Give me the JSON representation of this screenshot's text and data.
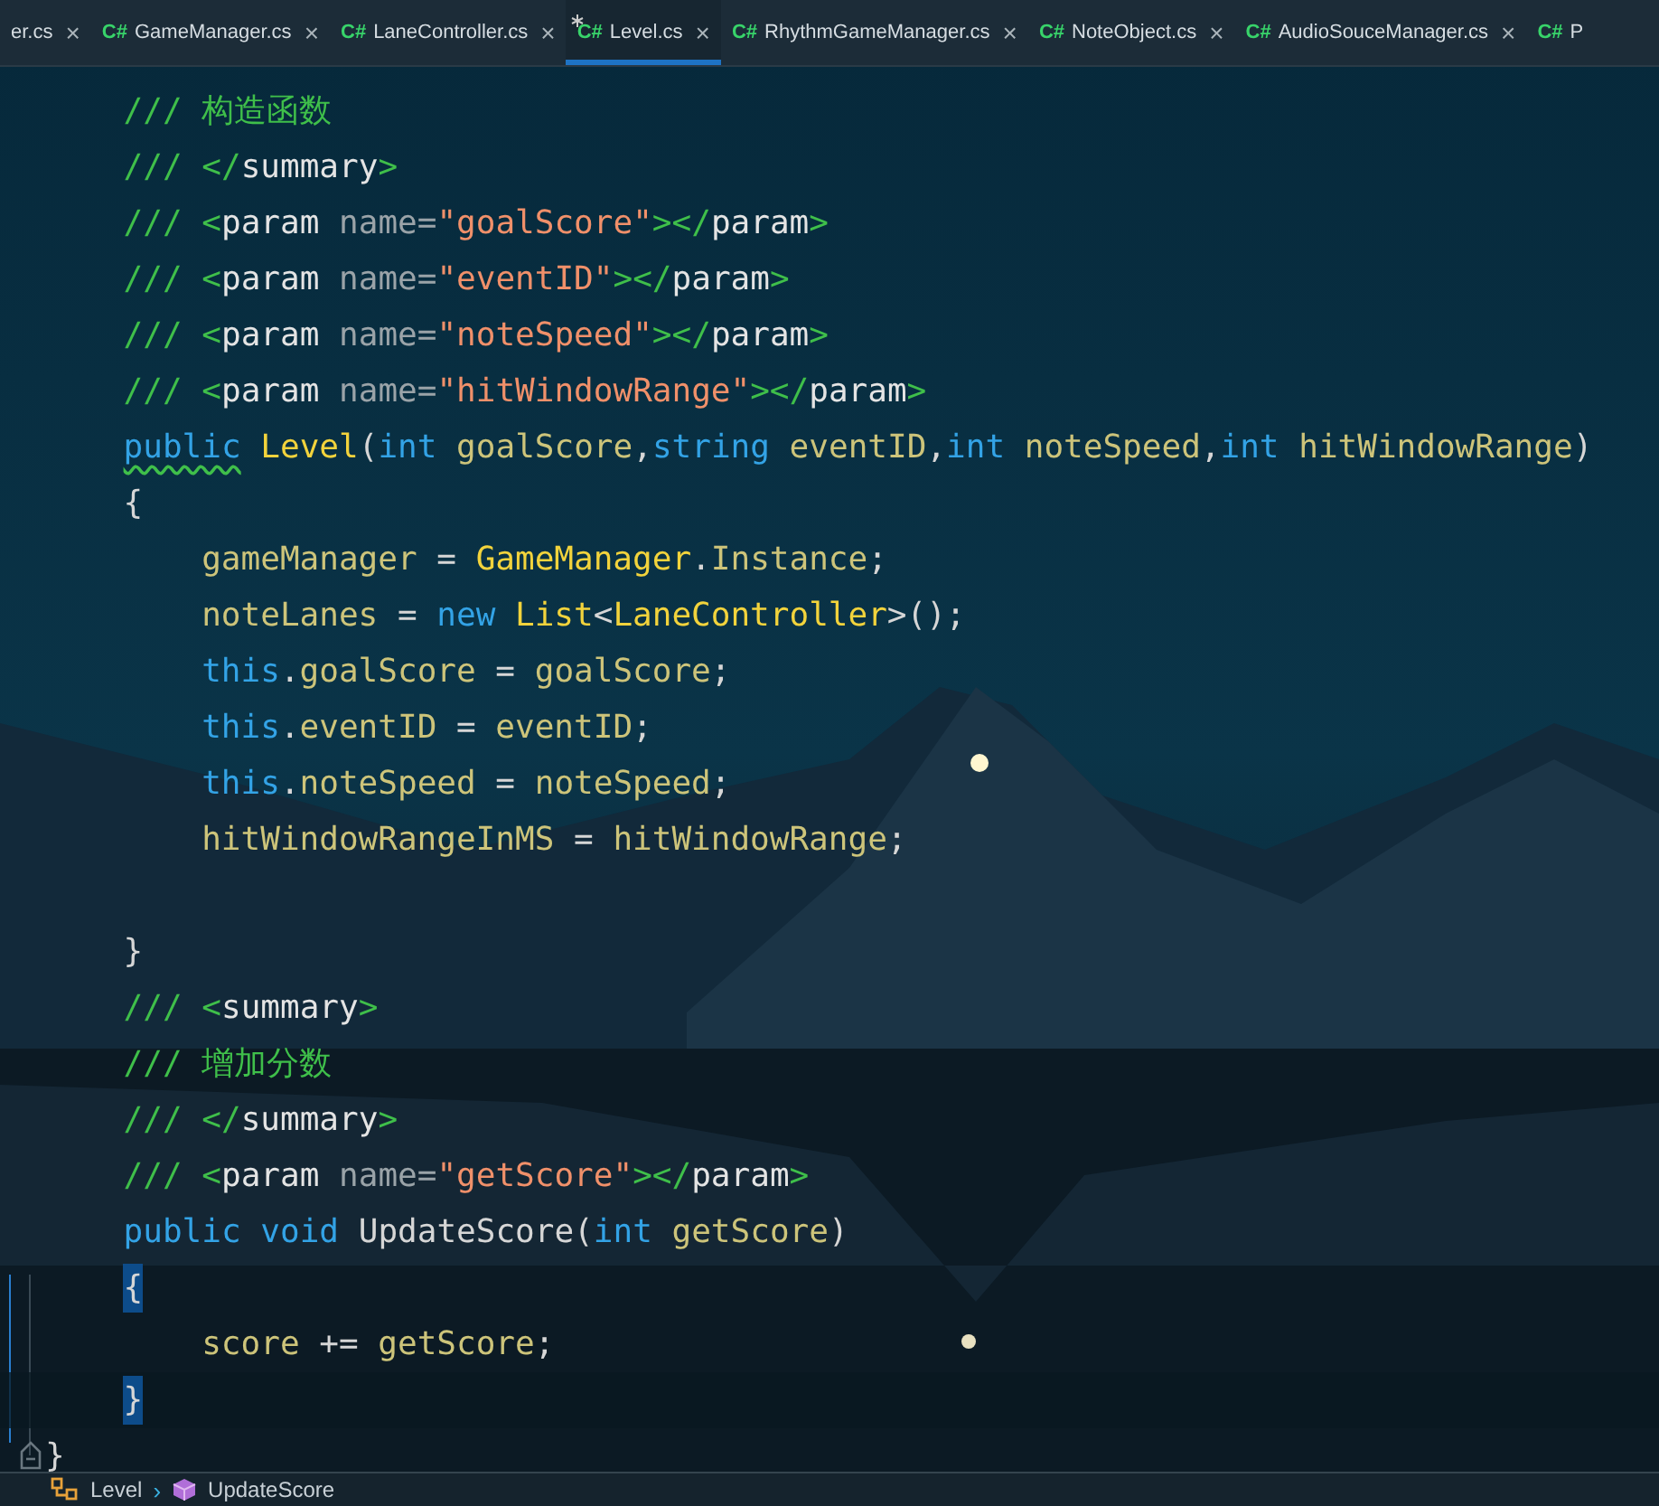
{
  "tabs": [
    {
      "label": "er.cs",
      "selected": false,
      "modified": false
    },
    {
      "icon": "C#",
      "label": "GameManager.cs",
      "selected": false,
      "modified": false
    },
    {
      "icon": "C#",
      "label": "LaneController.cs",
      "selected": false,
      "modified": false
    },
    {
      "icon": "C#",
      "label": "Level.cs",
      "selected": true,
      "modified": true
    },
    {
      "icon": "C#",
      "label": "RhythmGameManager.cs",
      "selected": false,
      "modified": false
    },
    {
      "icon": "C#",
      "label": "NoteObject.cs",
      "selected": false,
      "modified": false
    },
    {
      "icon": "C#",
      "label": "AudioSouceManager.cs",
      "selected": false,
      "modified": false
    },
    {
      "icon": "C#",
      "label": "P",
      "selected": false,
      "modified": false
    }
  ],
  "close_glyph": "×",
  "code_lines": [
    {
      "kind": "group",
      "children": [
        {
          "kind": "code",
          "tokens": [
            {
              "kind": "comment",
              "text": "/// 构造函数"
            }
          ]
        },
        {
          "kind": "code",
          "tokens": [
            {
              "kind": "comment",
              "text": "/// </"
            },
            {
              "kind": "tag",
              "text": "summary"
            },
            {
              "kind": "comment",
              "text": ">"
            }
          ]
        },
        {
          "kind": "code",
          "tokens": [
            {
              "kind": "comment",
              "text": "/// <"
            },
            {
              "kind": "tag",
              "text": "param "
            },
            {
              "kind": "attr",
              "text": "name="
            },
            {
              "kind": "string",
              "text": "\"goalScore\""
            },
            {
              "kind": "comment",
              "text": "></"
            },
            {
              "kind": "tag",
              "text": "param"
            },
            {
              "kind": "comment",
              "text": ">"
            }
          ]
        },
        {
          "kind": "code",
          "tokens": [
            {
              "kind": "comment",
              "text": "/// <"
            },
            {
              "kind": "tag",
              "text": "param "
            },
            {
              "kind": "attr",
              "text": "name="
            },
            {
              "kind": "string",
              "text": "\"eventID\""
            },
            {
              "kind": "comment",
              "text": "></"
            },
            {
              "kind": "tag",
              "text": "param"
            },
            {
              "kind": "comment",
              "text": ">"
            }
          ]
        },
        {
          "kind": "code",
          "tokens": [
            {
              "kind": "comment",
              "text": "/// <"
            },
            {
              "kind": "tag",
              "text": "param "
            },
            {
              "kind": "attr",
              "text": "name="
            },
            {
              "kind": "string",
              "text": "\"noteSpeed\""
            },
            {
              "kind": "comment",
              "text": "></"
            },
            {
              "kind": "tag",
              "text": "param"
            },
            {
              "kind": "comment",
              "text": ">"
            }
          ]
        },
        {
          "kind": "code",
          "tokens": [
            {
              "kind": "comment",
              "text": "/// <"
            },
            {
              "kind": "tag",
              "text": "param "
            },
            {
              "kind": "attr",
              "text": "name="
            },
            {
              "kind": "string",
              "text": "\"hitWindowRange\""
            },
            {
              "kind": "comment",
              "text": "></"
            },
            {
              "kind": "tag",
              "text": "param"
            },
            {
              "kind": "comment",
              "text": ">"
            }
          ]
        },
        {
          "kind": "code",
          "tokens": [
            {
              "kind": "keyword",
              "text": "public",
              "warning": true
            },
            {
              "kind": "type",
              "text": " Level"
            },
            {
              "kind": "plain",
              "text": "("
            },
            {
              "kind": "keyword",
              "text": "int"
            },
            {
              "kind": "ident",
              "text": " goalScore"
            },
            {
              "kind": "plain",
              "text": ","
            },
            {
              "kind": "keyword",
              "text": "string"
            },
            {
              "kind": "ident",
              "text": " eventID"
            },
            {
              "kind": "plain",
              "text": ","
            },
            {
              "kind": "keyword",
              "text": "int"
            },
            {
              "kind": "ident",
              "text": " noteSpeed"
            },
            {
              "kind": "plain",
              "text": ","
            },
            {
              "kind": "keyword",
              "text": "int"
            },
            {
              "kind": "ident",
              "text": " hitWindowRange"
            },
            {
              "kind": "plain",
              "text": ")"
            }
          ]
        },
        {
          "kind": "code",
          "tokens": [
            {
              "kind": "plain",
              "text": "{"
            }
          ],
          "children": [
            {
              "kind": "code",
              "tokens": [
                {
                  "kind": "ident",
                  "text": "gameManager"
                },
                {
                  "kind": "plain",
                  "text": " = "
                },
                {
                  "kind": "type",
                  "text": "GameManager"
                },
                {
                  "kind": "plain",
                  "text": "."
                },
                {
                  "kind": "ident",
                  "text": "Instance"
                },
                {
                  "kind": "plain",
                  "text": ";"
                }
              ]
            },
            {
              "kind": "code",
              "tokens": [
                {
                  "kind": "ident",
                  "text": "noteLanes"
                },
                {
                  "kind": "plain",
                  "text": " = "
                },
                {
                  "kind": "keyword",
                  "text": "new"
                },
                {
                  "kind": "type",
                  "text": " List"
                },
                {
                  "kind": "plain",
                  "text": "<"
                },
                {
                  "kind": "type",
                  "text": "LaneController"
                },
                {
                  "kind": "plain",
                  "text": ">();"
                }
              ]
            },
            {
              "kind": "code",
              "tokens": [
                {
                  "kind": "keyword",
                  "text": "this"
                },
                {
                  "kind": "plain",
                  "text": "."
                },
                {
                  "kind": "ident",
                  "text": "goalScore"
                },
                {
                  "kind": "plain",
                  "text": " = "
                },
                {
                  "kind": "ident",
                  "text": "goalScore"
                },
                {
                  "kind": "plain",
                  "text": ";"
                }
              ]
            },
            {
              "kind": "code",
              "tokens": [
                {
                  "kind": "keyword",
                  "text": "this"
                },
                {
                  "kind": "plain",
                  "text": "."
                },
                {
                  "kind": "ident",
                  "text": "eventID"
                },
                {
                  "kind": "plain",
                  "text": " = "
                },
                {
                  "kind": "ident",
                  "text": "eventID"
                },
                {
                  "kind": "plain",
                  "text": ";"
                }
              ]
            },
            {
              "kind": "code",
              "tokens": [
                {
                  "kind": "keyword",
                  "text": "this"
                },
                {
                  "kind": "plain",
                  "text": "."
                },
                {
                  "kind": "ident",
                  "text": "noteSpeed"
                },
                {
                  "kind": "plain",
                  "text": " = "
                },
                {
                  "kind": "ident",
                  "text": "noteSpeed"
                },
                {
                  "kind": "plain",
                  "text": ";"
                }
              ]
            },
            {
              "kind": "code",
              "tokens": [
                {
                  "kind": "ident",
                  "text": "hitWindowRangeInMS"
                },
                {
                  "kind": "plain",
                  "text": " = "
                },
                {
                  "kind": "ident",
                  "text": "hitWindowRange"
                },
                {
                  "kind": "plain",
                  "text": ";"
                }
              ]
            },
            {
              "kind": "blank"
            }
          ]
        },
        {
          "kind": "code",
          "tokens": [
            {
              "kind": "plain",
              "text": "}"
            }
          ]
        },
        {
          "kind": "code",
          "tokens": [
            {
              "kind": "comment",
              "text": "/// <"
            },
            {
              "kind": "tag",
              "text": "summary"
            },
            {
              "kind": "comment",
              "text": ">"
            }
          ]
        },
        {
          "kind": "code",
          "tokens": [
            {
              "kind": "comment",
              "text": "/// 增加分数"
            }
          ]
        },
        {
          "kind": "code",
          "tokens": [
            {
              "kind": "comment",
              "text": "/// </"
            },
            {
              "kind": "tag",
              "text": "summary"
            },
            {
              "kind": "comment",
              "text": ">"
            }
          ]
        },
        {
          "kind": "code",
          "tokens": [
            {
              "kind": "comment",
              "text": "/// <"
            },
            {
              "kind": "tag",
              "text": "param "
            },
            {
              "kind": "attr",
              "text": "name="
            },
            {
              "kind": "string",
              "text": "\"getScore\""
            },
            {
              "kind": "comment",
              "text": "></"
            },
            {
              "kind": "tag",
              "text": "param"
            },
            {
              "kind": "comment",
              "text": ">"
            }
          ]
        },
        {
          "kind": "code",
          "tokens": [
            {
              "kind": "keyword",
              "text": "public"
            },
            {
              "kind": "keyword",
              "text": " void"
            },
            {
              "kind": "plain",
              "text": " UpdateScore("
            },
            {
              "kind": "keyword",
              "text": "int"
            },
            {
              "kind": "ident",
              "text": " getScore"
            },
            {
              "kind": "plain",
              "text": ")"
            }
          ]
        },
        {
          "kind": "code",
          "tokens": [
            {
              "kind": "plain",
              "text": "{",
              "matched": true
            }
          ],
          "children": [
            {
              "kind": "code",
              "tokens": [
                {
                  "kind": "ident",
                  "text": "score"
                },
                {
                  "kind": "plain",
                  "text": " += "
                },
                {
                  "kind": "ident",
                  "text": "getScore"
                },
                {
                  "kind": "plain",
                  "text": ";"
                }
              ]
            }
          ]
        },
        {
          "kind": "code",
          "current": true,
          "tokens": [
            {
              "kind": "plain",
              "text": "}",
              "matched": true
            }
          ]
        }
      ]
    },
    {
      "kind": "code",
      "tokens": [
        {
          "kind": "plain",
          "text": "}"
        }
      ]
    }
  ],
  "breadcrumb": [
    {
      "kind": "class",
      "label": "Level"
    },
    {
      "kind": "method",
      "label": "UpdateScore"
    }
  ],
  "breadcrumb_separator": "›"
}
